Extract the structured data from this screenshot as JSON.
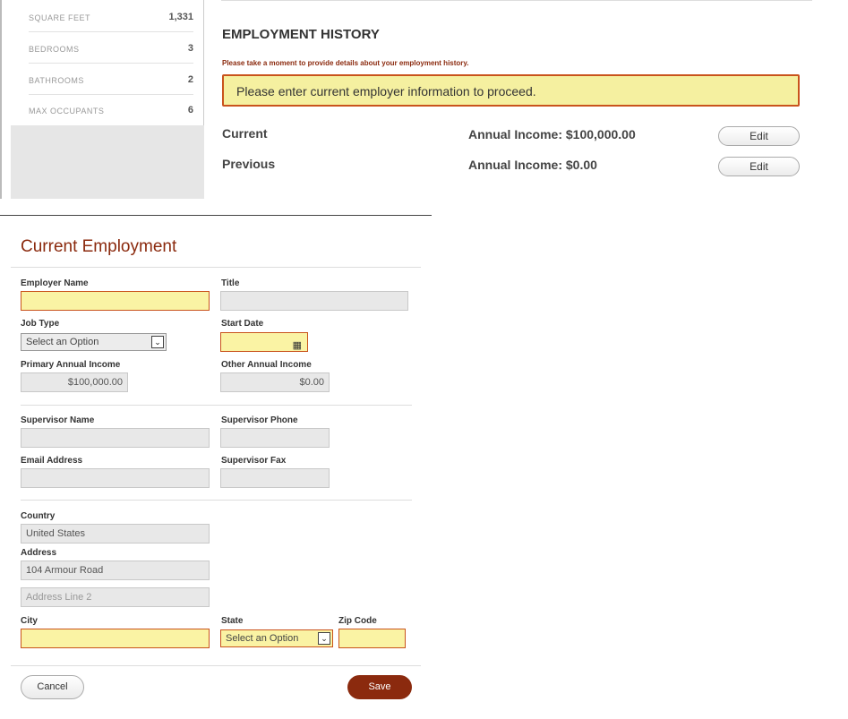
{
  "property": {
    "rows": [
      {
        "label": "SQUARE FEET",
        "value": "1,331"
      },
      {
        "label": "BEDROOMS",
        "value": "3"
      },
      {
        "label": "BATHROOMS",
        "value": "2"
      },
      {
        "label": "MAX OCCUPANTS",
        "value": "6"
      }
    ]
  },
  "history": {
    "heading": "EMPLOYMENT HISTORY",
    "subtext": "Please take a moment to provide details about your employment history.",
    "alert": "Please enter current employer information to proceed.",
    "entries": [
      {
        "label": "Current",
        "income": "Annual Income: $100,000.00",
        "edit": "Edit"
      },
      {
        "label": "Previous",
        "income": "Annual Income: $0.00",
        "edit": "Edit"
      }
    ]
  },
  "form": {
    "title": "Current Employment",
    "employer_name": {
      "label": "Employer Name",
      "value": ""
    },
    "title_field": {
      "label": "Title",
      "value": ""
    },
    "job_type": {
      "label": "Job Type",
      "value": "Select an Option"
    },
    "start_date": {
      "label": "Start Date",
      "value": ""
    },
    "primary_income": {
      "label": "Primary Annual Income",
      "value": "$100,000.00"
    },
    "other_income": {
      "label": "Other Annual Income",
      "value": "$0.00"
    },
    "supervisor_name": {
      "label": "Supervisor Name",
      "value": ""
    },
    "supervisor_phone": {
      "label": "Supervisor Phone",
      "value": ""
    },
    "email": {
      "label": "Email Address",
      "value": ""
    },
    "supervisor_fax": {
      "label": "Supervisor Fax",
      "value": ""
    },
    "country": {
      "label": "Country",
      "value": "United States"
    },
    "address": {
      "label": "Address",
      "value": "104 Armour Road",
      "line2_placeholder": "Address Line 2"
    },
    "city": {
      "label": "City",
      "value": ""
    },
    "state": {
      "label": "State",
      "value": "Select an Option"
    },
    "zip": {
      "label": "Zip Code",
      "value": ""
    },
    "cancel_label": "Cancel",
    "save_label": "Save"
  },
  "colors": {
    "accent": "#8b2a0e",
    "required_fill": "#faf3a4",
    "required_border": "#c9531c"
  },
  "icons": {
    "select_arrow": "chevron-down-icon",
    "calendar": "calendar-icon"
  }
}
